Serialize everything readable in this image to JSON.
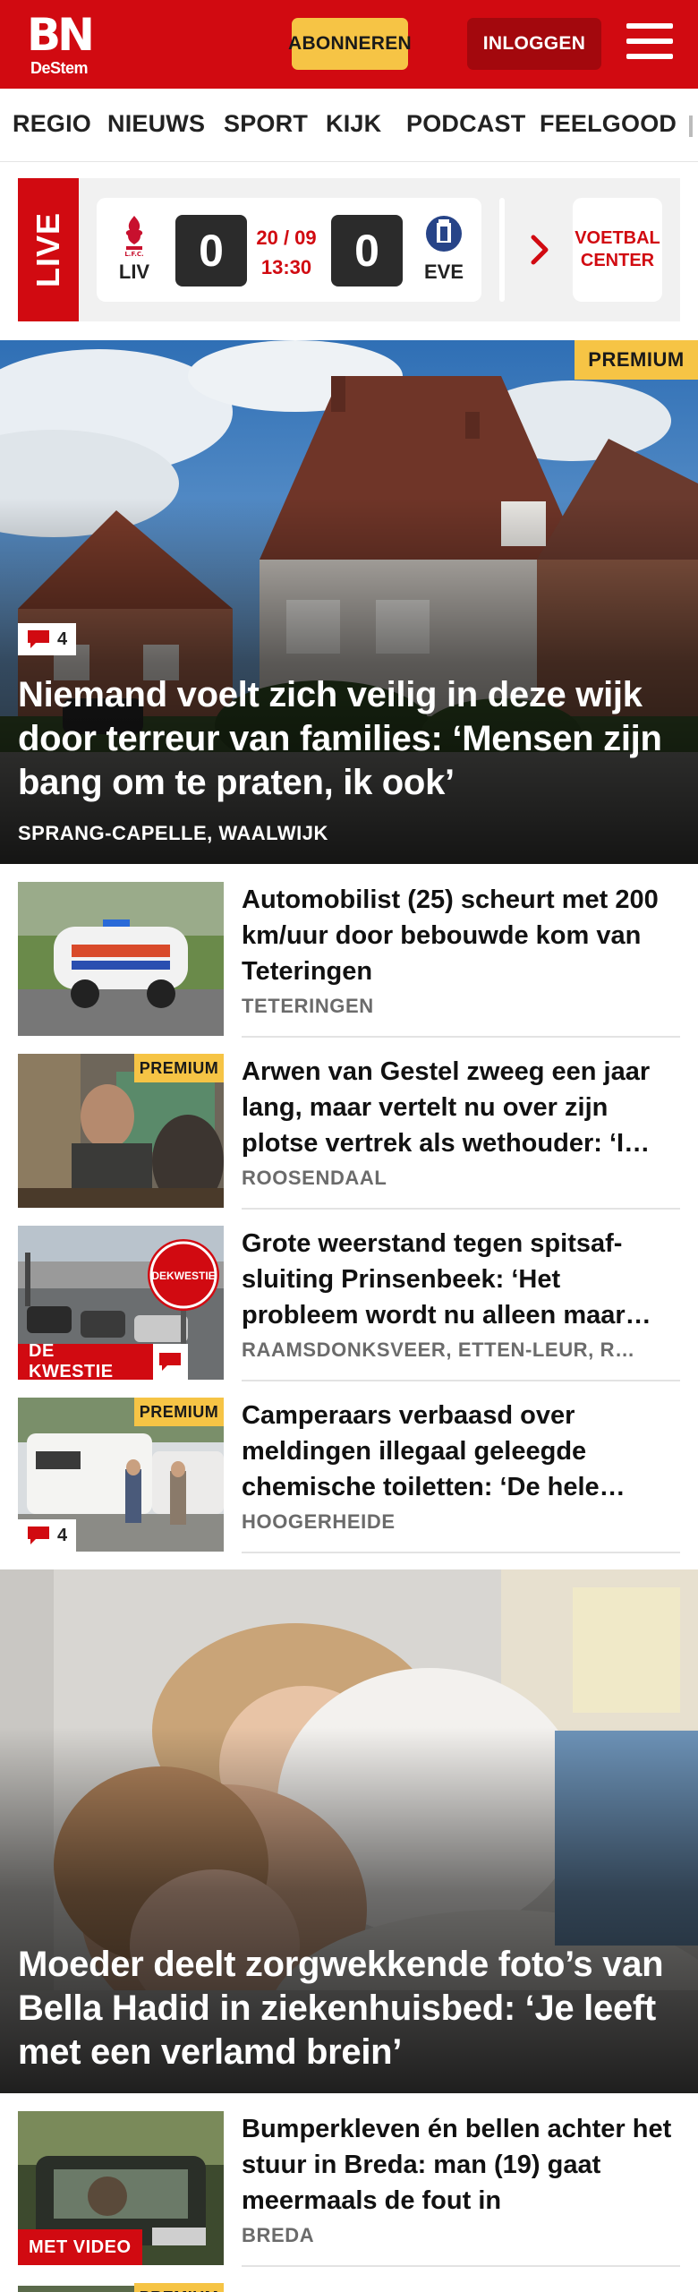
{
  "header": {
    "logo_main": "BN",
    "logo_sub": "DeStem",
    "subscribe_label": "ABONNEREN",
    "login_label": "INLOGGEN",
    "brand_color": "#d10a11",
    "accent_color": "#f6c445"
  },
  "nav": {
    "items": [
      "REGIO",
      "NIEUWS",
      "SPORT",
      "KIJK",
      "PODCAST",
      "FEELGOOD"
    ]
  },
  "live": {
    "label": "LIVE",
    "match": {
      "home": "LIV",
      "away": "EVE",
      "home_score": "0",
      "away_score": "0",
      "date": "20 / 09",
      "time": "13:30"
    },
    "voetbal_center_line1": "VOETBAL",
    "voetbal_center_line2": "CENTER"
  },
  "hero1": {
    "premium": "PREMIUM",
    "comments": "4",
    "title": "Niemand voelt zich veilig in deze wijk door terreur van families: ‘Mensen zijn bang om te praten, ik ook’",
    "location": "SPRANG-CAPELLE, WAALWIJK"
  },
  "articles": [
    {
      "title": "Automobilist (25) scheurt met 200 km/uur door bebouwde kom van Teteringen",
      "location": "TETERINGEN"
    },
    {
      "title": "Arwen van Gestel zweeg een jaar lang, maar vertelt nu over zijn plotse vertrek als wethouder: ‘I…",
      "location": "ROOSENDAAL",
      "premium": "PREMIUM"
    },
    {
      "title": "Grote weerstand tegen spitsaf­sluiting Prinsenbeek: ‘Het probleem wordt nu alleen maar…",
      "location": "RAAMSDONKSVEER, ETTEN-LEUR, R…",
      "label": "DE KWESTIE",
      "sign_text": "DEKWESTIE"
    },
    {
      "title": "Camperaars verbaasd over meldingen illegaal geleegde chemische toiletten: ‘De hele…",
      "location": "HOOGERHEIDE",
      "premium": "PREMIUM",
      "comments": "4"
    }
  ],
  "hero2": {
    "title": "Moeder deelt zorgwekkende foto’s van Bella Hadid in ziekenhuisbed: ‘Je leeft met een verlamd brein’"
  },
  "article5": {
    "title": "Bumperkleven én bellen achter het stuur in Breda: man (19) gaat meermaals de fout in",
    "location": "BREDA",
    "label": "MET VIDEO"
  },
  "article6": {
    "premium": "PREMIUM"
  }
}
